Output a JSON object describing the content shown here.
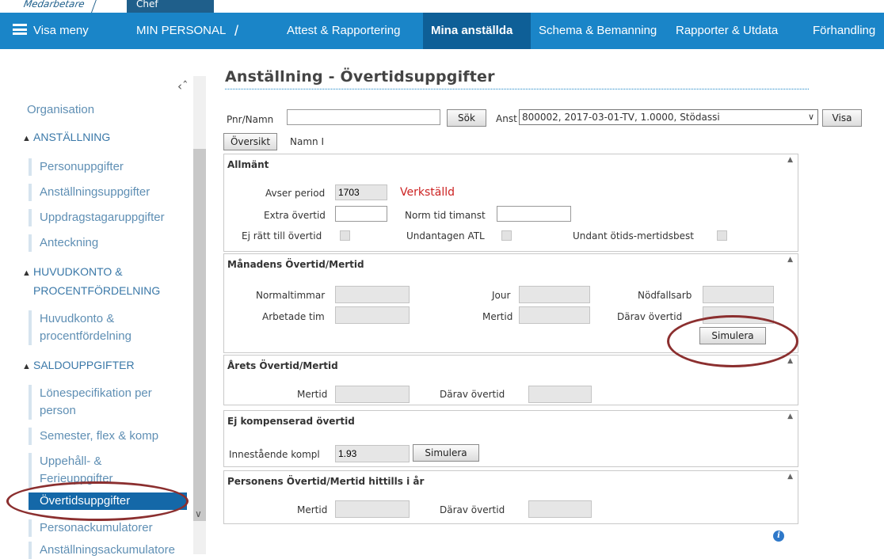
{
  "role_tabs": [
    "Medarbetare",
    "Chef"
  ],
  "navbar": {
    "menu_label": "Visa meny",
    "app_title": "MIN PERSONAL",
    "separator": "/",
    "items": [
      "Attest & Rapportering",
      "Mina anställda",
      "Schema & Bemanning",
      "Rapporter & Utdata",
      "Förhandling"
    ],
    "active": "Mina anställda"
  },
  "sidebar": {
    "organisation": "Organisation",
    "sections": [
      {
        "title": "ANSTÄLLNING",
        "items": [
          "Personuppgifter",
          "Anställningsuppgifter",
          "Uppdragstagaruppgifter",
          "Anteckning"
        ]
      },
      {
        "title_line1": "HUVUDKONTO &",
        "title_line2": "PROCENTFÖRDELNING",
        "items_line1": "Huvudkonto &",
        "items_line2": "procentfördelning"
      },
      {
        "title": "SALDOUPPGIFTER",
        "item1_line1": "Lönespecifikation per",
        "item1_line2": "person",
        "item2": "Semester, flex & komp",
        "item3_line1": "Uppehåll- &",
        "item3_line2": "Ferieuppgifter",
        "item4": "Övertidsuppgifter",
        "item5": "Personackumulatorer",
        "item6": "Anställningsackumulatore"
      }
    ]
  },
  "page_title": "Anställning - Övertidsuppgifter",
  "search": {
    "pnr_label": "Pnr/Namn",
    "pnr_value": "",
    "search_button": "Sök",
    "anst_label": "Anst",
    "anst_value": "800002, 2017-03-01-TV, 1.0000, Stödassi",
    "show_button": "Visa",
    "overview_button": "Översikt",
    "name_label": "Namn I"
  },
  "allmant": {
    "title": "Allmänt",
    "avser_period_label": "Avser period",
    "avser_period_value": "1703",
    "status": "Verkställd",
    "extra_overtid_label": "Extra övertid",
    "extra_overtid_value": "",
    "norm_tid_label": "Norm tid timanst",
    "norm_tid_value": "",
    "ej_ratt_label": "Ej rätt till övertid",
    "undantagen_atl_label": "Undantagen ATL",
    "undant_otids_label": "Undant ötids-mertidsbest"
  },
  "manadens": {
    "title": "Månadens Övertid/Mertid",
    "normaltimmar_label": "Normaltimmar",
    "jour_label": "Jour",
    "nodfallsarb_label": "Nödfallsarb",
    "arbetade_tim_label": "Arbetade tim",
    "mertid_label": "Mertid",
    "darav_overtid_label": "Därav övertid",
    "simulate_button": "Simulera"
  },
  "arets": {
    "title": "Årets Övertid/Mertid",
    "mertid_label": "Mertid",
    "darav_overtid_label": "Därav övertid"
  },
  "ej_kompenserad": {
    "title": "Ej kompenserad övertid",
    "innestaende_label": "Innestående kompl",
    "innestaende_value": "1.93",
    "simulate_button": "Simulera"
  },
  "personens": {
    "title": "Personens Övertid/Mertid hittills i år",
    "mertid_label": "Mertid",
    "darav_overtid_label": "Därav övertid"
  },
  "colors": {
    "nav_bg": "#1a85c8",
    "nav_active": "#0e5f97",
    "status_red": "#cc2222",
    "annotation": "#8b2f2f"
  }
}
